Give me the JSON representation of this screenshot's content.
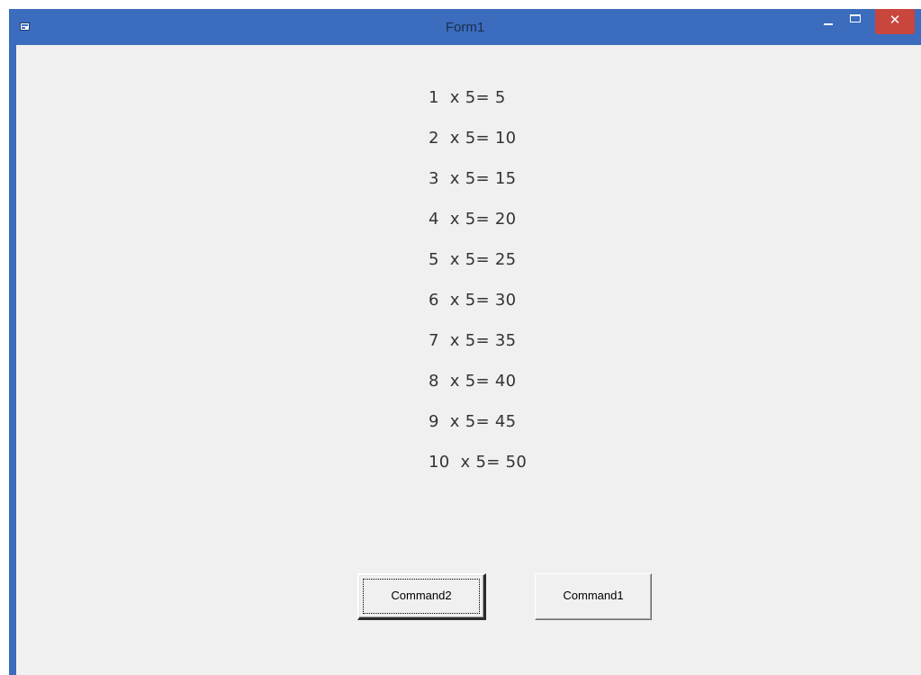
{
  "window": {
    "title": "Form1",
    "close_glyph": "✕",
    "accent_color": "#3b6cbd",
    "close_color": "#c9463d"
  },
  "results": [
    "1  x 5= 5",
    "2  x 5= 10",
    "3  x 5= 15",
    "4  x 5= 20",
    "5  x 5= 25",
    "6  x 5= 30",
    "7  x 5= 35",
    "8  x 5= 40",
    "9  x 5= 45",
    "10  x 5= 50"
  ],
  "buttons": {
    "command2": "Command2",
    "command1": "Command1"
  }
}
